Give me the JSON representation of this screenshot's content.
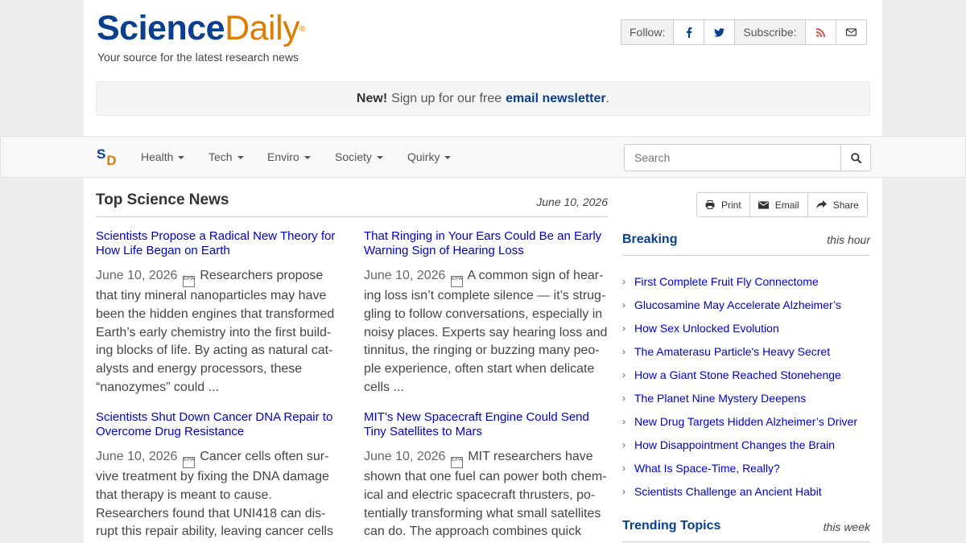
{
  "header": {
    "logo_science": "Science",
    "logo_daily": "Daily",
    "logo_mark": "®",
    "tagline": "Your source for the latest research news",
    "follow_label": "Follow:",
    "subscribe_label": "Subscribe:"
  },
  "newsletter": {
    "new_label": "New!",
    "text": "Sign up for our free",
    "link": "email newsletter",
    "end": "."
  },
  "nav": {
    "logo_s": "S",
    "logo_d": "D",
    "items": [
      "Health",
      "Tech",
      "Enviro",
      "Society",
      "Quirky"
    ],
    "search_placeholder": "Search"
  },
  "main": {
    "title": "Top Science News",
    "date": "June 10, 2026",
    "stories": [
      {
        "headline": "Scientists Propose a Radical New Theory for How Life Began on Earth",
        "date": "June 10, 2026",
        "separator": "EPA",
        "summary": "Researchers propose that tiny mineral nanoparticles may have been the hidden engines that transformed Earth’s early chemistry into the first build-ing blocks of life. By acting as natural cat-alysts and energy processors, these “nanozymes” could ..."
      },
      {
        "headline": "That Ringing in Your Ears Could Be an Early Warning Sign of Hearing Loss",
        "date": "June 10, 2026",
        "separator": "EPA",
        "summary": "A common sign of hear-ing loss isn’t complete silence — it’s strug-gling to follow conversations, especially in noisy places. Experts say hearing loss and tinnitus, the ringing or buzzing many peo-ple experience, often start when delicate cells ..."
      },
      {
        "headline": "Scientists Shut Down Cancer DNA Repair to Overcome Drug Resistance",
        "date": "June 10, 2026",
        "separator": "EPA",
        "summary": "Cancer cells often sur-vive treatment by fixing the DNA damage that therapy is meant to cause. Researchers found that UNI418 can dis-rupt this repair ability, leaving cancer cells more exposed. When combined with ..."
      },
      {
        "headline": "MIT’s New Spacecraft Engine Could Send Tiny Satellites to Mars",
        "date": "June 10, 2026",
        "separator": "EPA",
        "summary": "MIT researchers have shown that one fuel can power both chem-ical and electric spacecraft thrusters, po-tentially transforming what small satellites can do. The approach combines quick bursts of speed with highly efficient long ..."
      }
    ]
  },
  "tools": {
    "print": "Print",
    "email": "Email",
    "share": "Share"
  },
  "breaking": {
    "title": "Breaking",
    "note": "this hour",
    "items": [
      "First Complete Fruit Fly Connectome",
      "Glucosamine May Accelerate Alzheimer’s",
      "How Sex Unlocked Evolution",
      "The Amaterasu Particle's Heavy Secret",
      "How a Giant Stone Reached Stonehenge",
      "The Planet Nine Mystery Deepens",
      "New Drug Targets Hidden Alzheimer’s Driver",
      "How Disappointment Changes the Brain",
      "What Is Space-Time, Really?",
      "Scientists Challenge an Ancient Habit"
    ]
  },
  "trending": {
    "title": "Trending Topics",
    "note": "this week"
  },
  "colors": {
    "brand_blue": "#0a3f8f",
    "brand_orange": "#e07b00",
    "link": "#0000cc"
  }
}
